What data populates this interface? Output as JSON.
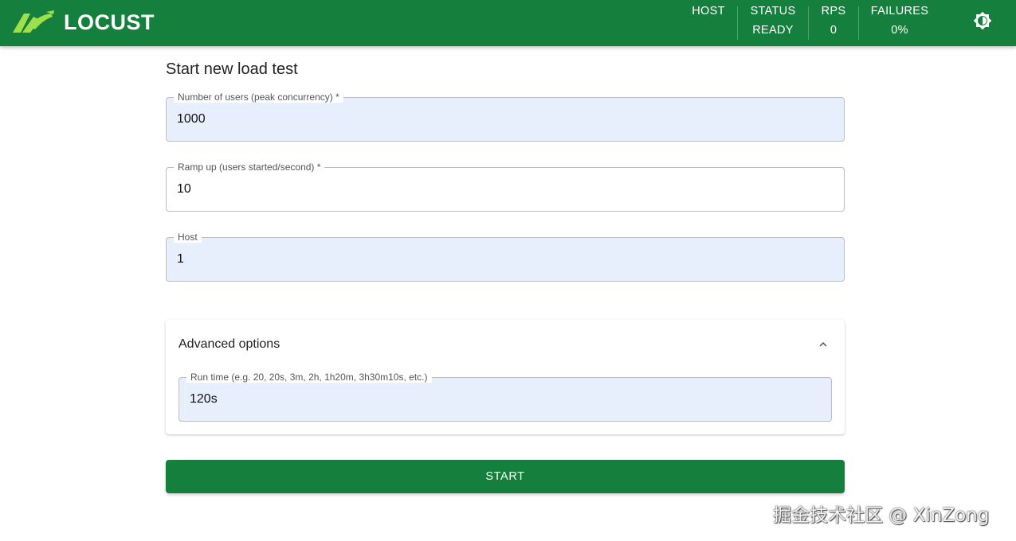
{
  "header": {
    "brand": "LOCUST",
    "stats": [
      {
        "key": "HOST",
        "value": ""
      },
      {
        "key": "STATUS",
        "value": "READY"
      },
      {
        "key": "RPS",
        "value": "0"
      },
      {
        "key": "FAILURES",
        "value": "0%"
      }
    ],
    "theme_icon": "brightness-icon",
    "color": "#15803d"
  },
  "form": {
    "title": "Start new load test",
    "users": {
      "label": "Number of users (peak concurrency)",
      "required": "*",
      "value": "1000"
    },
    "ramp_up": {
      "label": "Ramp up (users started/second)",
      "required": "*",
      "value": "10"
    },
    "host": {
      "label": "Host",
      "value": "1"
    },
    "advanced": {
      "title": "Advanced options",
      "expanded": true,
      "run_time": {
        "label": "Run time (e.g. 20, 20s, 3m, 2h, 1h20m, 3h30m10s, etc.)",
        "value": "120s"
      }
    },
    "start_label": "START"
  },
  "watermark": "掘金技术社区 @ XinZong"
}
